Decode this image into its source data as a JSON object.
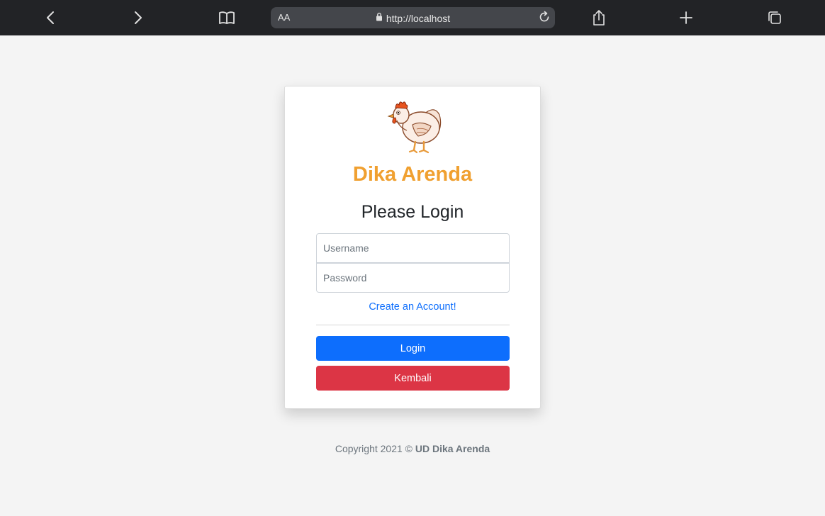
{
  "browser": {
    "text_size_label": "AA",
    "url": "http://localhost",
    "icons": [
      "back-icon",
      "forward-icon",
      "bookmarks-icon",
      "lock-icon",
      "reload-icon",
      "share-icon",
      "new-tab-icon",
      "tabs-icon"
    ]
  },
  "login": {
    "brand": "Dika Arenda",
    "heading": "Please Login",
    "username_placeholder": "Username",
    "password_placeholder": "Password",
    "create_account": "Create an Account!",
    "login_button": "Login",
    "back_button": "Kembali",
    "logo_icon": "chicken-logo-icon"
  },
  "footer": {
    "copyright": "Copyright 2021 ©",
    "company": "UD Dika Arenda"
  },
  "colors": {
    "toolbar_bg": "#222326",
    "brand": "#f0a030",
    "primary": "#0d6efd",
    "danger": "#dc3545",
    "page_bg": "#f4f4f4"
  }
}
